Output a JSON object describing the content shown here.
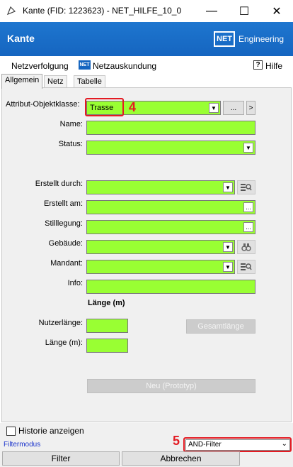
{
  "window": {
    "title": "Kante (FID: 1223623) - NET_HILFE_10_0",
    "minimize": "—",
    "maximize": "☐",
    "close": "✕"
  },
  "header": {
    "title": "Kante",
    "logo": "NET",
    "brand": "Engineering"
  },
  "menu": {
    "item1": "Netzverfolgung",
    "item2_icon": "NET",
    "item2": "Netzauskundung",
    "help_icon": "?",
    "help": "Hilfe"
  },
  "tabs": [
    "Allgemein",
    "Netz",
    "Tabelle"
  ],
  "form": {
    "objektklasse_label": "Attribut-Objektklasse:",
    "objektklasse_value": "Trasse",
    "dots": "...",
    "next": ">",
    "name_label": "Name:",
    "status_label": "Status:",
    "erstellt_durch_label": "Erstellt durch:",
    "erstellt_am_label": "Erstellt am:",
    "stilllegung_label": "Stilllegung:",
    "gebaeude_label": "Gebäude:",
    "mandant_label": "Mandant:",
    "info_label": "Info:",
    "laenge_heading": "Länge (m)",
    "nutzerlaenge_label": "Nutzerlänge:",
    "laenge_label": "Länge (m):",
    "gesamtlaenge_button": "Gesamtlänge",
    "neu_button": "Neu (Prototyp)",
    "dropdown_arrow": "▼"
  },
  "annotations": {
    "a4": "4",
    "a5": "5"
  },
  "bottom": {
    "historie_label": "Historie anzeigen",
    "filtermodus_label": "Filtermodus",
    "filter_value": "AND-Filter",
    "filter_button": "Filter",
    "abbrechen_button": "Abbrechen"
  },
  "colors": {
    "field_fill": "#99ff33",
    "header_blue": "#1565c0",
    "annotation_red": "#e31b23"
  }
}
